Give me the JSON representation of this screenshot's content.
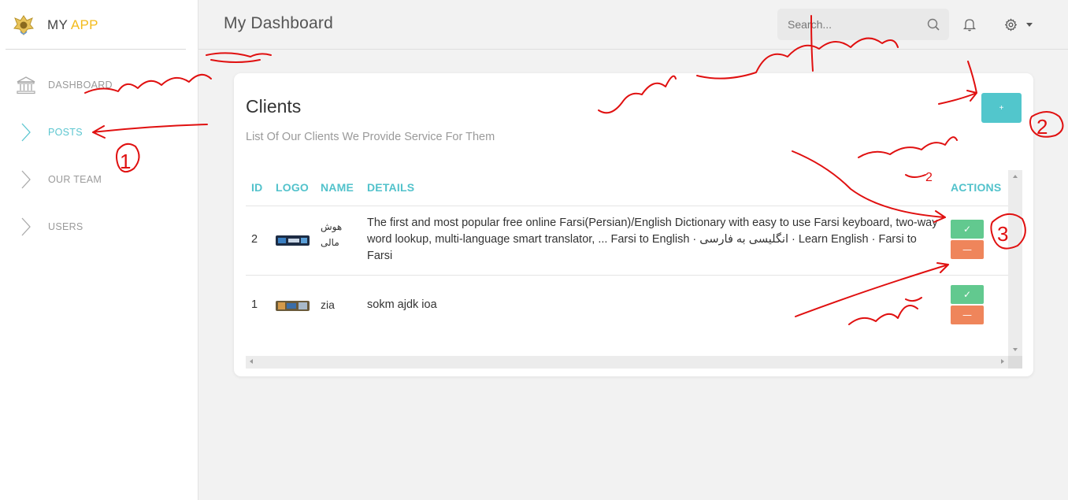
{
  "app": {
    "brand_prefix": "MY",
    "brand_accent": "APP",
    "accent_color": "#f3bb1c",
    "primary_color": "#52c6cc"
  },
  "sidebar": {
    "items": [
      {
        "label": "DASHBOARD",
        "icon": "bank-icon",
        "active": false
      },
      {
        "label": "POSTS",
        "icon": "chevron-right-icon",
        "active": true
      },
      {
        "label": "OUR TEAM",
        "icon": "chevron-right-icon",
        "active": false
      },
      {
        "label": "USERS",
        "icon": "chevron-right-icon",
        "active": false
      }
    ]
  },
  "header": {
    "title": "My Dashboard",
    "search_placeholder": "Search..."
  },
  "card": {
    "title": "Clients",
    "subtitle": "List Of Our Clients We Provide Service For Them",
    "add_label": "+"
  },
  "table": {
    "columns": [
      "ID",
      "LOGO",
      "NAME",
      "DETAILS",
      "ACTIONS"
    ],
    "rows": [
      {
        "id": "2",
        "name_line1": "هوش",
        "name_line2": "مالی",
        "details": "The first and most popular free online Farsi(Persian)/English Dictionary with easy to use Farsi keyboard, two-way word lookup, multi-language smart translator, ... Farsi to English · انگلیسی به فارسی · Learn English · Farsi to Farsi"
      },
      {
        "id": "1",
        "name_line1": "zia",
        "name_line2": "",
        "details": "sokm ajdk ioa"
      }
    ],
    "edit_icon": "check-icon",
    "delete_icon": "minus-icon",
    "edit_symbol": "✓",
    "delete_symbol": "—"
  },
  "annotations": {
    "label_1": "1",
    "label_2": "2",
    "label_3": "3",
    "label_2_small": "2"
  }
}
